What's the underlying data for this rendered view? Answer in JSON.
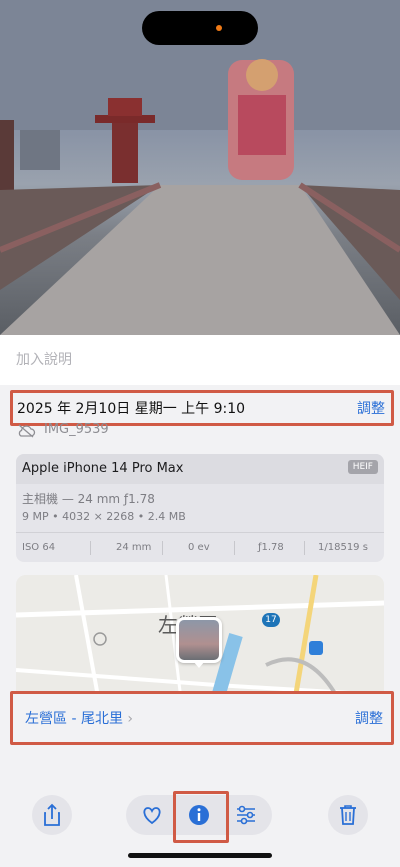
{
  "photo": {
    "alt": "photo-preview"
  },
  "caption": {
    "placeholder": "加入說明"
  },
  "date_row": {
    "date": "2025 年 2月10日 星期一 上午 9:10",
    "adjust": "調整"
  },
  "file": {
    "name": "IMG_9539"
  },
  "camera": {
    "model": "Apple iPhone 14 Pro Max",
    "format": "HEIF",
    "lens": "主相機 — 24 mm ƒ1.78",
    "specs": "9 MP • 4032 × 2268 • 2.4 MB",
    "exif": [
      "ISO 64",
      "24 mm",
      "0 ev",
      "ƒ1.78",
      "1/18519 s"
    ]
  },
  "map": {
    "label": "左營區",
    "route": "17"
  },
  "location": {
    "name": "左營區 - 尾北里",
    "adjust": "調整"
  },
  "toolbar": {
    "icons": [
      "share-icon",
      "heart-icon",
      "info-icon",
      "adjust-icon",
      "trash-icon"
    ]
  },
  "colors": {
    "accent": "#2a6fd6",
    "highlight": "#d05a45"
  }
}
